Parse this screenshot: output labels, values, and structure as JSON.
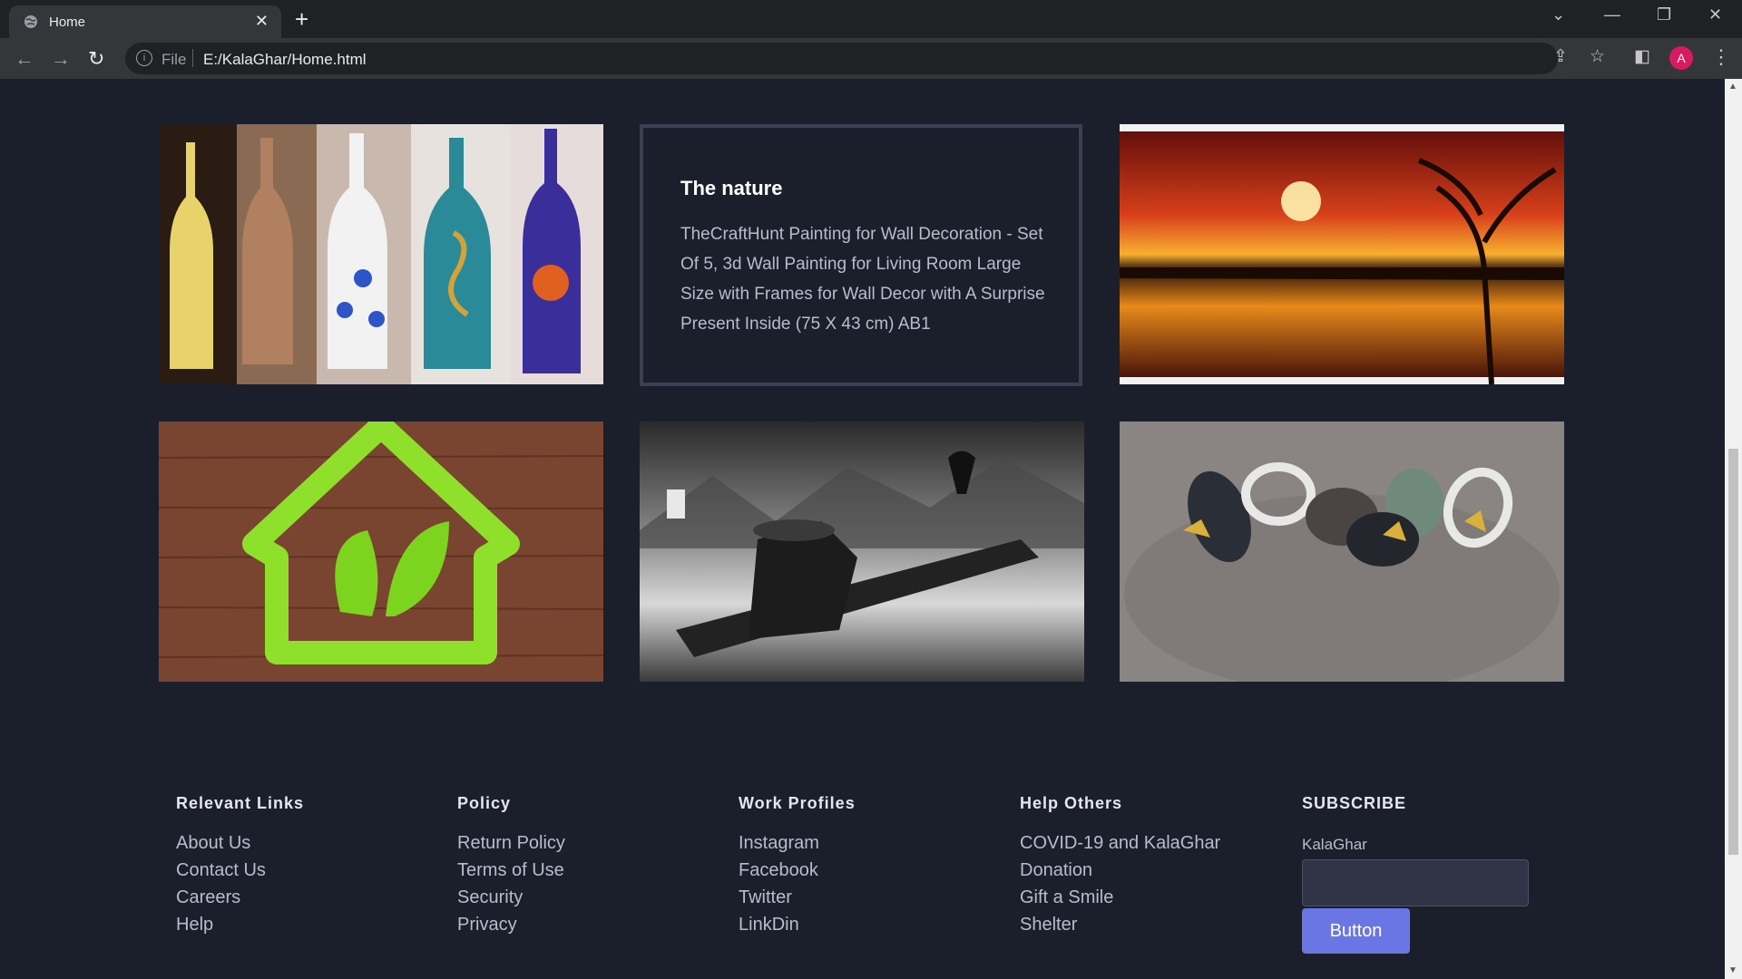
{
  "browser": {
    "tab_title": "Home",
    "url_scheme": "File",
    "url": "E:/KalaGhar/Home.html",
    "avatar_letter": "A"
  },
  "gallery": {
    "card": {
      "title": "The nature",
      "description": "TheCraftHunt Painting for Wall Decoration - Set Of 5, 3d Wall Painting for Living Room Large Size with Frames for Wall Decor with A Surprise Present Inside (75 X 43 cm) AB1"
    }
  },
  "footer": {
    "columns": [
      {
        "heading": "Relevant Links",
        "links": [
          "About Us",
          "Contact Us",
          "Careers",
          "Help"
        ]
      },
      {
        "heading": "Policy",
        "links": [
          "Return Policy",
          "Terms of Use",
          "Security",
          "Privacy"
        ]
      },
      {
        "heading": "Work Profiles",
        "links": [
          "Instagram",
          "Facebook",
          "Twitter",
          "LinkDin"
        ]
      },
      {
        "heading": "Help Others",
        "links": [
          "COVID-19 and KalaGhar",
          "Donation",
          "Gift a Smile",
          "Shelter"
        ]
      }
    ],
    "subscribe": {
      "heading": "SUBSCRIBE",
      "label": "KalaGhar",
      "button": "Button"
    }
  },
  "colors": {
    "page_bg": "#1b1e2b",
    "button_bg": "#6a76e3",
    "card_border": "#3b4054"
  }
}
